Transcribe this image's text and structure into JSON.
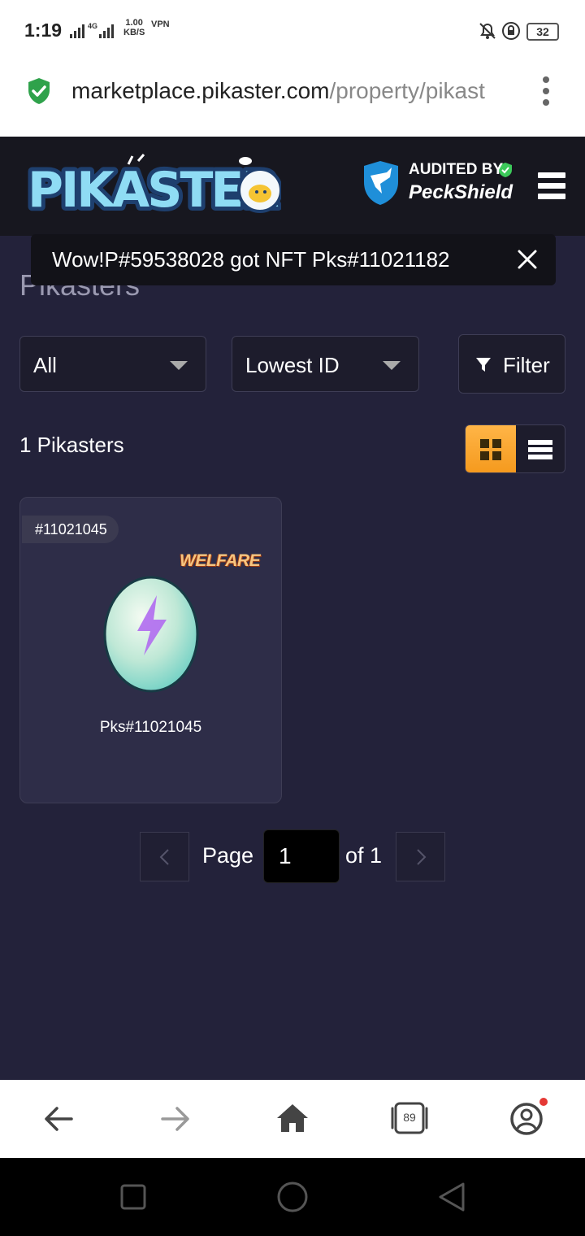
{
  "status_bar": {
    "time": "1:19",
    "network": "4G",
    "speed_value": "1.00",
    "speed_unit": "KB/S",
    "vpn": "VPN",
    "battery": "32"
  },
  "browser": {
    "url_host": "marketplace.pikaster.com",
    "url_path": "/property/pikast",
    "tabs_count": "89"
  },
  "site_header": {
    "logo_text": "PIKASTER",
    "audit_title": "AUDITED BY",
    "audit_name": "PeckShield"
  },
  "toast": {
    "message": "Wow!P#59538028 got NFT Pks#11021182"
  },
  "page_title": "Pikasters",
  "filters": {
    "type_value": "All",
    "sort_value": "Lowest ID",
    "filter_label": "Filter"
  },
  "results": {
    "count_label": "1 Pikasters"
  },
  "card": {
    "id_badge": "#11021045",
    "tag": "WELFARE",
    "name": "Pks#11021045"
  },
  "pagination": {
    "page_label": "Page",
    "current_page": "1",
    "of_label": "of 1"
  },
  "colors": {
    "page_bg": "#23223a",
    "header_bg": "#17171f",
    "card_bg": "#2e2d48",
    "accent": "#f9a634"
  }
}
